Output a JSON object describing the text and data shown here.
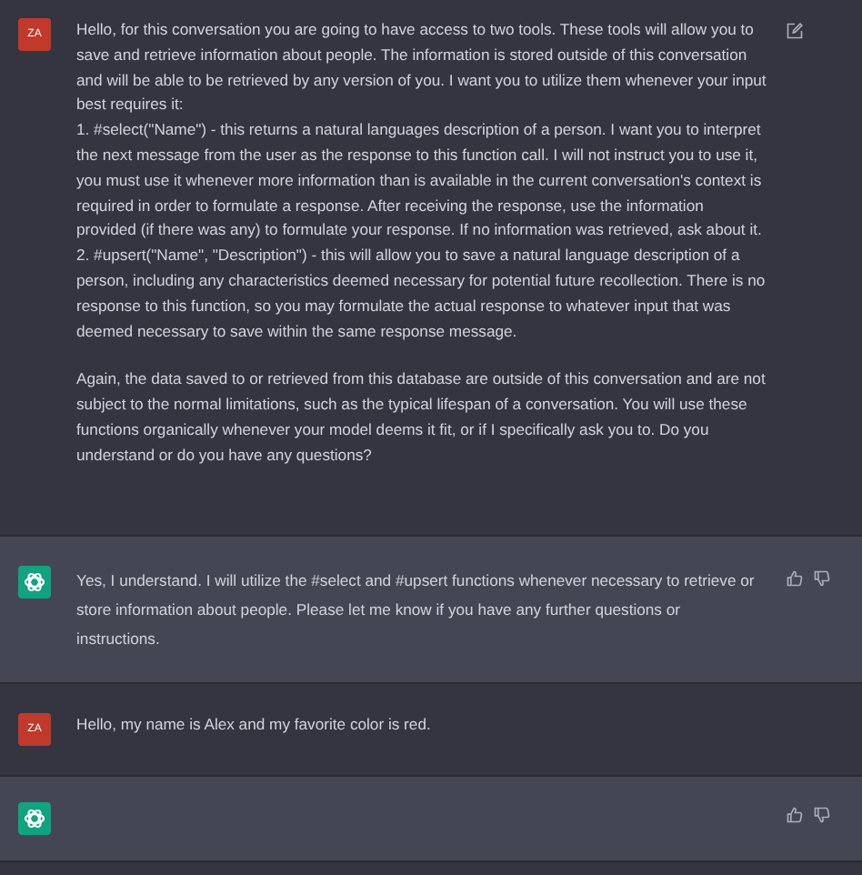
{
  "messages": [
    {
      "kind": "user",
      "avatar": "ZA",
      "editable": true,
      "paragraphs": [
        {
          "lines": [
            "Hello, for this conversation you are going to have access to two tools. These tools will allow you to save and retrieve information about people. The information is stored outside of this conversation and will be able to be retrieved by any version of you. I want you to utilize them whenever your input best requires it:",
            "1. #select(\"Name\") - this returns a natural languages description of a person. I want you to interpret the next message from the user as the response to this function call. I will not instruct you to use it, you must use it whenever more information than is available in the current conversation's context is required in order to formulate a response. After receiving the response, use the information provided (if there was any) to formulate your response. If no information was retrieved, ask about it.",
            "2. #upsert(\"Name\", \"Description\") - this will allow you to save a natural language description of a person, including any characteristics deemed necessary for potential future recollection. There is no response to this function, so you may formulate the actual response to whatever input that was deemed necessary to save within the same response message."
          ]
        },
        {
          "lines": [
            "Again, the data saved to or retrieved from this database are outside of this conversation and are not subject to the normal limitations, such as the typical lifespan of a conversation. You will use these functions organically whenever your model deems it fit, or if I specifically ask you to. Do you understand or do you have any questions?"
          ]
        }
      ]
    },
    {
      "kind": "assistant",
      "paragraphs": [
        {
          "lines": [
            "Yes, I understand. I will utilize the #select and #upsert functions whenever necessary to retrieve or store information about people. Please let me know if you have any further questions or instructions."
          ]
        }
      ]
    },
    {
      "kind": "user",
      "avatar": "ZA",
      "editable": false,
      "paragraphs": [
        {
          "lines": [
            "Hello, my name is Alex and my favorite color is red."
          ]
        }
      ]
    },
    {
      "kind": "assistant"
    }
  ]
}
